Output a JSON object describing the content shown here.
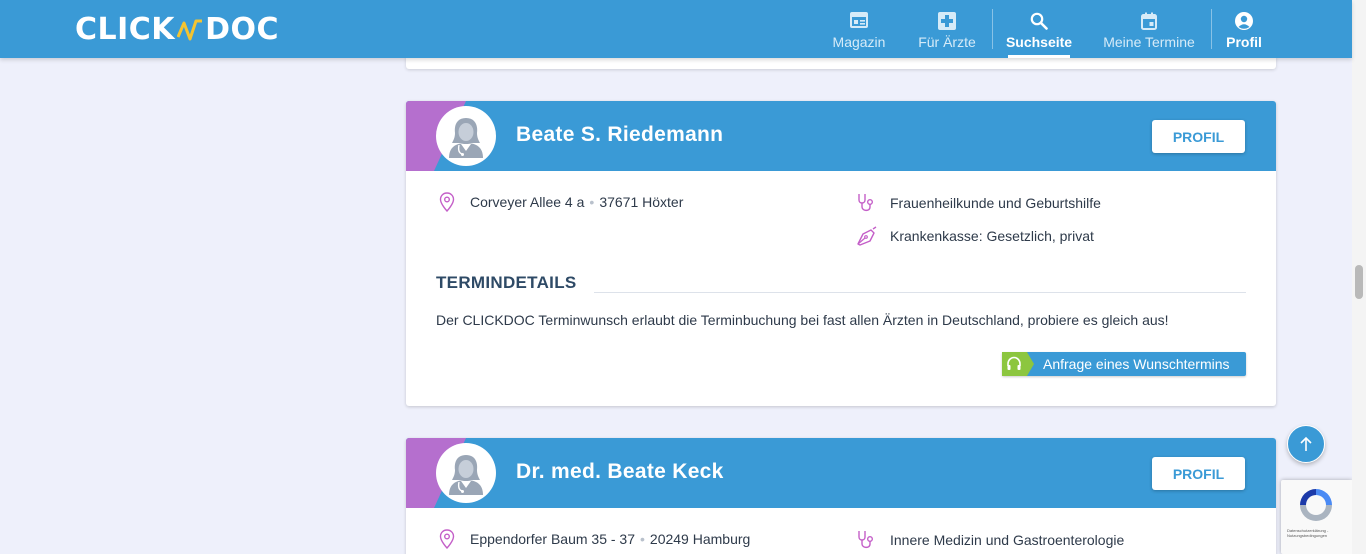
{
  "header": {
    "logo_left": "CLICK",
    "logo_right": "DOC",
    "nav": [
      {
        "label": "Magazin",
        "icon": "magazine-icon"
      },
      {
        "label": "Für Ärzte",
        "icon": "medical-cross-icon"
      },
      {
        "label": "Suchseite",
        "icon": "search-icon",
        "active": true
      },
      {
        "label": "Meine Termine",
        "icon": "calendar-icon"
      },
      {
        "label": "Profil",
        "icon": "user-icon"
      }
    ]
  },
  "colors": {
    "primary": "#3a9ad6",
    "accent_purple": "#b56fce",
    "accent_green": "#8cc63f",
    "background": "#eef0fb",
    "icon_pink": "#c45fc8"
  },
  "cards": [
    {
      "name": "Beate S. Riedemann",
      "profile_label": "PROFIL",
      "street": "Corveyer Allee 4 a",
      "city": "37671 Höxter",
      "specialty": "Frauenheilkunde und Geburtshilfe",
      "insurance": "Krankenkasse: Gesetzlich, privat",
      "section_title": "TERMINDETAILS",
      "section_text": "Der CLICKDOC Terminwunsch erlaubt die Terminbuchung bei fast allen Ärzten in Deutschland, probiere es gleich aus!",
      "request_label": "Anfrage eines Wunschtermins"
    },
    {
      "name": "Dr. med. Beate Keck",
      "profile_label": "PROFIL",
      "street": "Eppendorfer Baum 35 - 37",
      "city": "20249 Hamburg",
      "specialty": "Innere Medizin und Gastroenterologie"
    }
  ],
  "recaptcha": {
    "text": "Datenschutzerklärung - Nutzungsbedingungen"
  }
}
